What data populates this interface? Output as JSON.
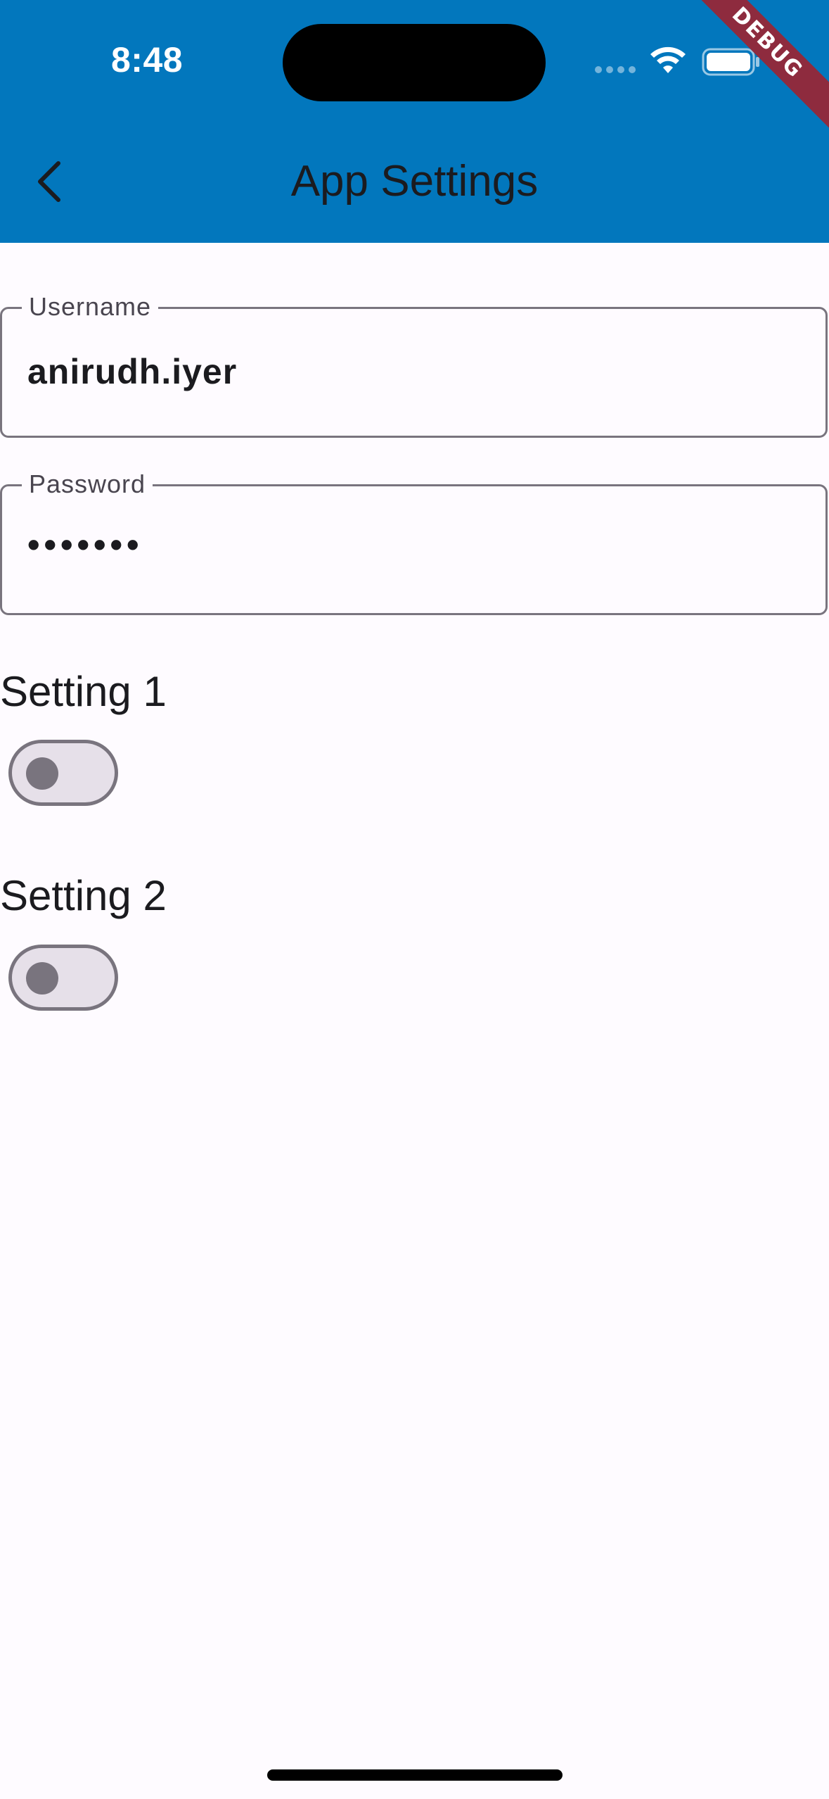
{
  "status_bar": {
    "time": "8:48"
  },
  "debug_banner": "DEBUG",
  "header": {
    "title": "App Settings",
    "back_icon": "chevron-left-icon"
  },
  "form": {
    "username": {
      "label": "Username",
      "value": "anirudh.iyer"
    },
    "password": {
      "label": "Password",
      "masked_value": "•••••••"
    }
  },
  "settings": [
    {
      "label": "Setting 1",
      "enabled": false
    },
    {
      "label": "Setting 2",
      "enabled": false
    }
  ],
  "colors": {
    "app_bar": "#0277bd",
    "background": "#fefbff",
    "outline": "#79747e",
    "debug_banner": "#8e2b3e"
  }
}
